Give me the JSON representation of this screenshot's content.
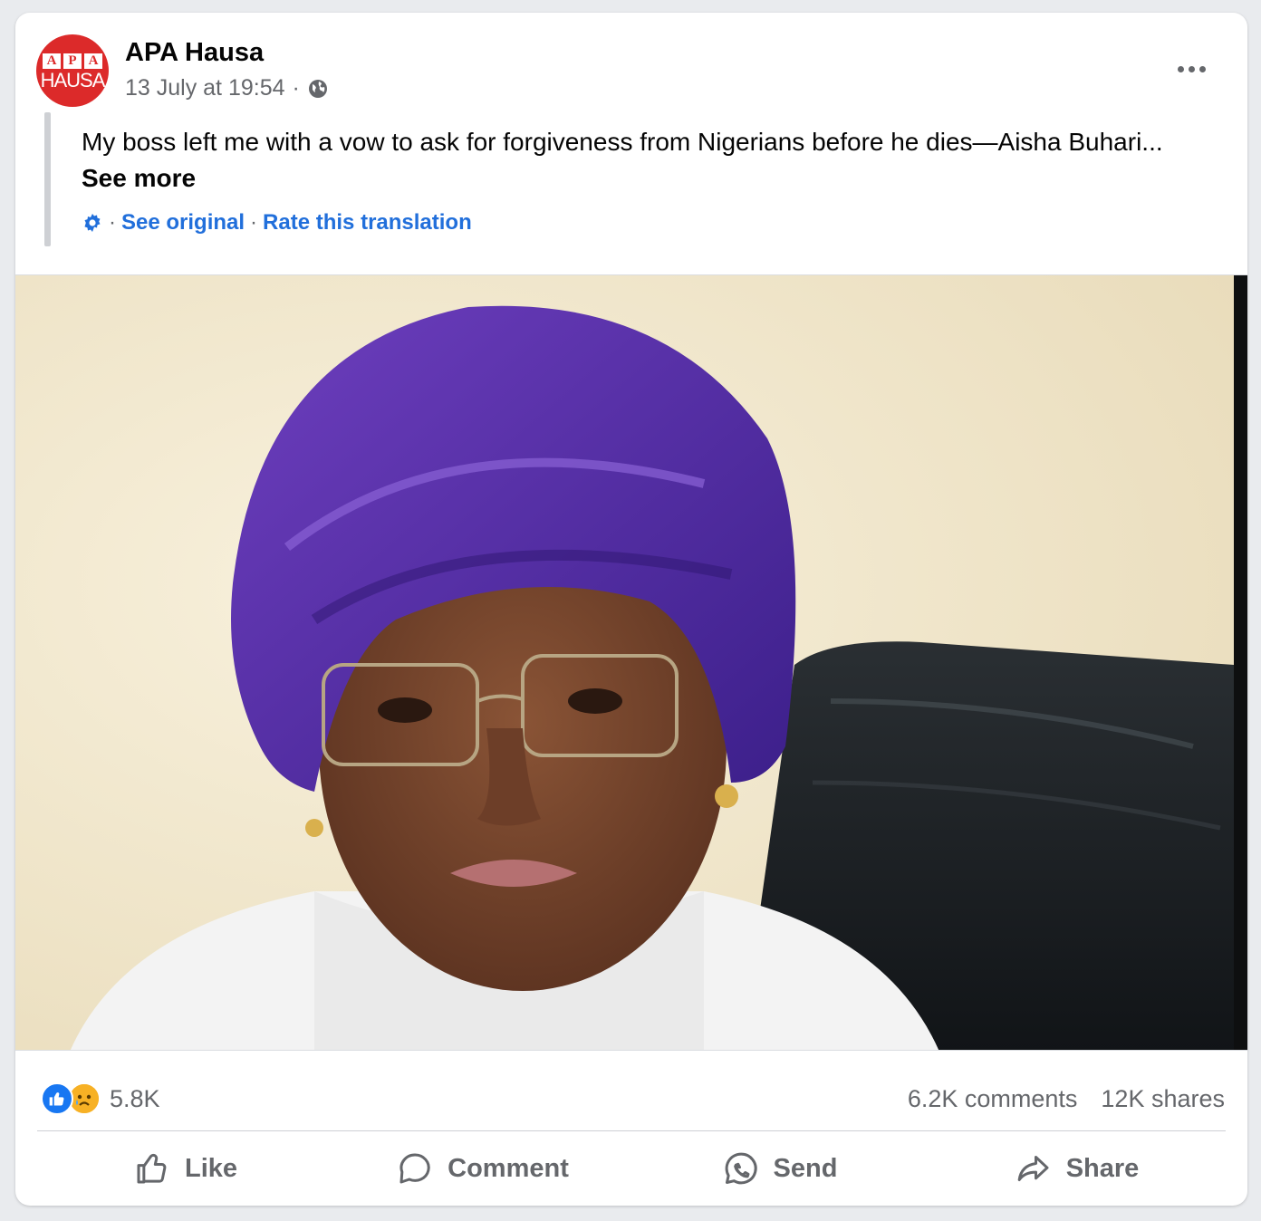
{
  "post": {
    "page_name": "APA Hausa",
    "avatar": {
      "top_letters": [
        "A",
        "P",
        "A"
      ],
      "bottom_text": "HAUSA",
      "color": "#dc2a2a"
    },
    "timestamp": "13 July at 19:54",
    "separator": "·",
    "audience_icon": "globe-icon",
    "text": "My boss left me with a vow to ask for forgiveness from Nigerians before he dies—Aisha Buhari...",
    "see_more": "See more",
    "translation": {
      "icon": "gear-icon",
      "see_original": "See original",
      "rate": "Rate this translation"
    }
  },
  "stats": {
    "reaction_count": "5.8K",
    "reactions": [
      "like",
      "sad"
    ],
    "comments": "6.2K comments",
    "shares": "12K shares"
  },
  "actions": [
    {
      "label": "Like",
      "icon": "thumbs-up-icon"
    },
    {
      "label": "Comment",
      "icon": "comment-icon"
    },
    {
      "label": "Send",
      "icon": "messenger-send-icon"
    },
    {
      "label": "Share",
      "icon": "share-arrow-icon"
    }
  ],
  "colors": {
    "link": "#216fdb",
    "muted": "#65676b",
    "like_blue": "#1877f2",
    "sad_yellow": "#f7b125"
  }
}
